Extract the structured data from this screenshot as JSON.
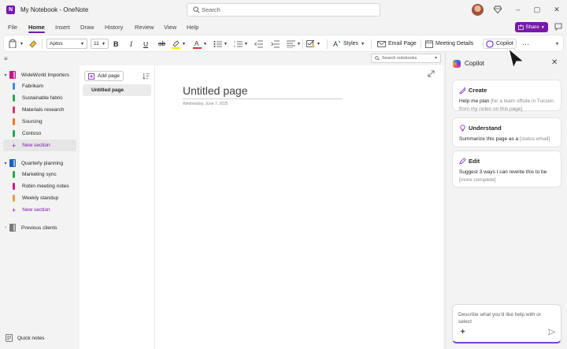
{
  "window": {
    "title": "My Notebook - OneNote",
    "app_logo_letter": "N"
  },
  "search": {
    "placeholder": "Search"
  },
  "menu": {
    "tabs": [
      "File",
      "Home",
      "Insert",
      "Draw",
      "History",
      "Review",
      "View",
      "Help"
    ],
    "active": "Home",
    "share_label": "Share"
  },
  "ribbon": {
    "font_name": "Aptos",
    "font_size": "11",
    "bold": "B",
    "italic": "I",
    "underline": "U",
    "strike": "ab",
    "styles_label": "Styles",
    "email_page_label": "Email Page",
    "meeting_details_label": "Meeting Details",
    "copilot_label": "Copilot",
    "more_label": "···"
  },
  "notebook": {
    "search_placeholder": "Search notebooks",
    "groups": [
      {
        "name": "WideWorld Importers",
        "color": "#c4188a",
        "sections": [
          {
            "name": "Fabrikam",
            "color": "#3a8fd8"
          },
          {
            "name": "Sustainable fabric",
            "color": "#2aa84a"
          },
          {
            "name": "Materials research",
            "color": "#d23a6a"
          },
          {
            "name": "Sourcing",
            "color": "#f07a1f"
          },
          {
            "name": "Contoso",
            "color": "#27a84a"
          }
        ],
        "new_section": "New section"
      },
      {
        "name": "Quarterly planning",
        "color": "#1d5fb4",
        "sections": [
          {
            "name": "Marketing sync",
            "color": "#27a84a"
          },
          {
            "name": "Robin meeting notes",
            "color": "#c4188a"
          },
          {
            "name": "Weekly standup",
            "color": "#e0a040"
          }
        ],
        "new_section": "New section"
      },
      {
        "name": "Previous clients",
        "color": "#7a7a7a"
      }
    ],
    "quick_notes": "Quick notes"
  },
  "pages": {
    "add_page": "Add page",
    "items": [
      "Untitled page"
    ]
  },
  "page": {
    "title": "Untitled page",
    "date": "Wednesday, June 7, 2025"
  },
  "copilot": {
    "title": "Copilot",
    "cards": [
      {
        "heading": "Create",
        "text": "Help me plan",
        "placeholder": "[for a team offsite in Tucson from my notes on this page]"
      },
      {
        "heading": "Understand",
        "text": "Summarize this page as a",
        "placeholder": "[status email]"
      },
      {
        "heading": "Edit",
        "text": "Suggest 3 ways I can rewrite this to be",
        "placeholder": "[more complete]"
      }
    ],
    "input_placeholder": "Describe what you'd like help with or select"
  },
  "colors": {
    "accent": "#7719aa",
    "copilot_gradient": "#7d3fd6"
  }
}
